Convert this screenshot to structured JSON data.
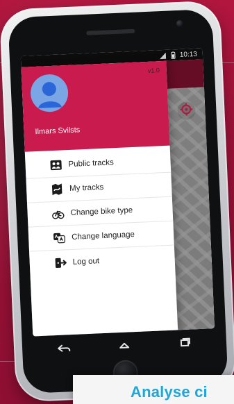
{
  "status_bar": {
    "time": "10:13",
    "signal_icon": "signal-icon",
    "battery_icon": "battery-icon"
  },
  "drawer": {
    "version": "v1.0",
    "user_name": "Ilmars Svilsts",
    "avatar_icon": "user-avatar-icon",
    "items": [
      {
        "label": "Public tracks",
        "icon": "people-map-icon"
      },
      {
        "label": "My tracks",
        "icon": "map-track-icon"
      },
      {
        "label": "Change bike type",
        "icon": "bike-icon"
      },
      {
        "label": "Change language",
        "icon": "translate-icon"
      },
      {
        "label": "Log out",
        "icon": "logout-icon"
      }
    ]
  },
  "map": {
    "locate_icon": "locate-icon"
  },
  "nav_bar": {
    "back_icon": "back-icon",
    "home_icon": "home-icon",
    "recent_icon": "recent-apps-icon"
  },
  "caption": {
    "text": "Analyse ci"
  },
  "colors": {
    "accent": "#c91b4d",
    "background": "#8f0f33",
    "caption_text": "#1ea7d8"
  }
}
